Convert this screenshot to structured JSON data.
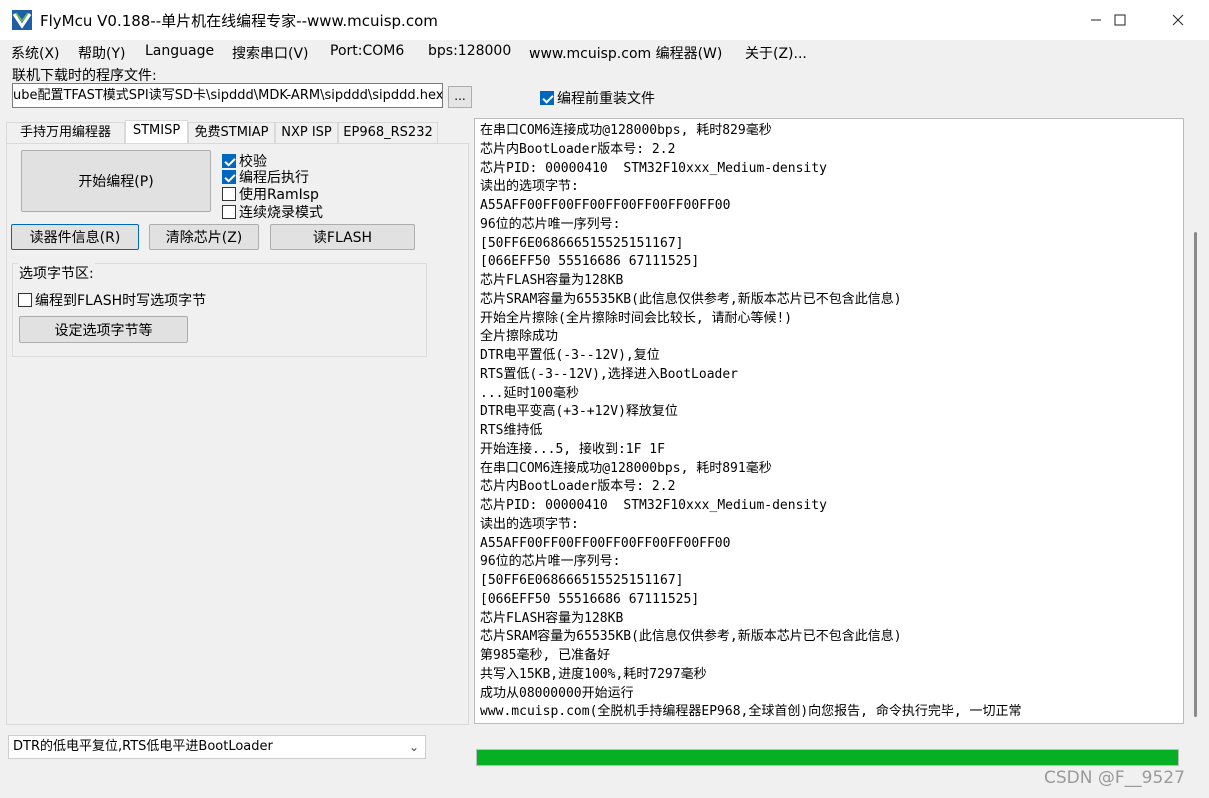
{
  "window": {
    "title": "FlyMcu V0.188--单片机在线编程专家--www.mcuisp.com",
    "minimize_icon": "minimize-icon",
    "maximize_icon": "maximize-icon",
    "close_icon": "close-icon"
  },
  "menu": [
    "系统(X)",
    "帮助(Y)",
    "Language",
    "搜索串口(V)",
    "Port:COM6",
    "bps:128000",
    "www.mcuisp.com 编程器(W)",
    "关于(Z)..."
  ],
  "file": {
    "label": "联机下载时的程序文件:",
    "path": "ube配置TFAST模式SPI读写SD卡\\sipddd\\MDK-ARM\\sipddd\\sipddd.hex",
    "browse_label": "...",
    "reload_label": "编程前重装文件",
    "reload_checked": true
  },
  "tabs": [
    "手持万用编程器",
    "STMISP",
    "免费STMIAP",
    "NXP ISP",
    "EP968_RS232"
  ],
  "active_tab": "STMISP",
  "buttons": {
    "start": "开始编程(P)",
    "read_info": "读器件信息(R)",
    "erase": "清除芯片(Z)",
    "read_flash": "读FLASH",
    "set_options": "设定选项字节等"
  },
  "options": {
    "verify": {
      "label": "校验",
      "checked": true
    },
    "run_after": {
      "label": "编程后执行",
      "checked": true
    },
    "ramisp": {
      "label": "使用RamIsp",
      "checked": false
    },
    "continuous": {
      "label": "连续烧录模式",
      "checked": false
    }
  },
  "option_bytes": {
    "group_title": "选项字节区:",
    "write_option": {
      "label": "编程到FLASH时写选项字节",
      "checked": false
    }
  },
  "mode_select": "DTR的低电平复位,RTS低电平进BootLoader",
  "log": [
    "在串口COM6连接成功@128000bps, 耗时829毫秒",
    "芯片内BootLoader版本号: 2.2",
    "芯片PID: 00000410  STM32F10xxx_Medium-density",
    "读出的选项字节:",
    "A55AFF00FF00FF00FF00FF00FF00FF00",
    "96位的芯片唯一序列号:",
    "[50FF6E068666515525151167]",
    "[066EFF50 55516686 67111525]",
    "芯片FLASH容量为128KB",
    "芯片SRAM容量为65535KB(此信息仅供参考,新版本芯片已不包含此信息)",
    "开始全片擦除(全片擦除时间会比较长, 请耐心等候!)",
    "全片擦除成功",
    "DTR电平置低(-3--12V),复位",
    "RTS置低(-3--12V),选择进入BootLoader",
    "...延时100毫秒",
    "DTR电平变高(+3-+12V)释放复位",
    "RTS维持低",
    "开始连接...5, 接收到:1F 1F",
    "在串口COM6连接成功@128000bps, 耗时891毫秒",
    "芯片内BootLoader版本号: 2.2",
    "芯片PID: 00000410  STM32F10xxx_Medium-density",
    "读出的选项字节:",
    "A55AFF00FF00FF00FF00FF00FF00FF00",
    "96位的芯片唯一序列号:",
    "[50FF6E068666515525151167]",
    "[066EFF50 55516686 67111525]",
    "芯片FLASH容量为128KB",
    "芯片SRAM容量为65535KB(此信息仅供参考,新版本芯片已不包含此信息)",
    "第985毫秒, 已准备好",
    "共写入15KB,进度100%,耗时7297毫秒",
    "成功从08000000开始运行",
    "www.mcuisp.com(全脱机手持编程器EP968,全球首创)向您报告, 命令执行完毕, 一切正常"
  ],
  "progress": {
    "fraction": 1.0,
    "color": "#06b025"
  },
  "watermark": "CSDN @F__9527",
  "colors": {
    "accent": "#0067c0",
    "progress": "#06b025"
  }
}
